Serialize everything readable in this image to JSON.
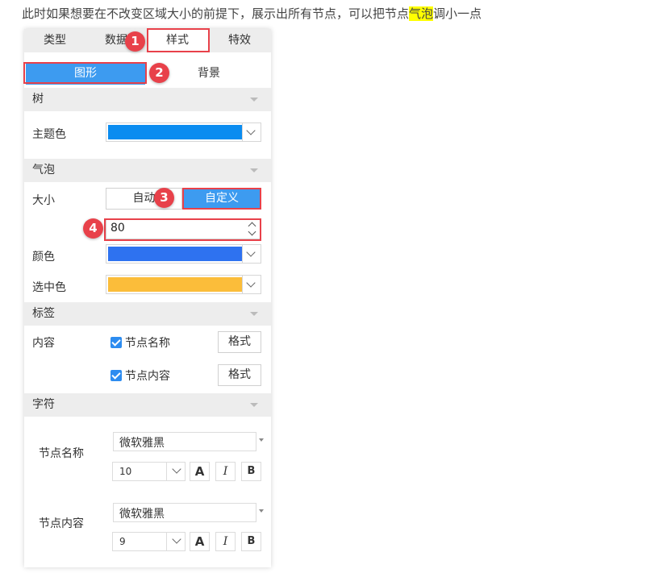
{
  "intro": {
    "before": "此时如果想要在不改变区域大小的前提下，展示出所有节点，可以把节点",
    "highlight": "气泡",
    "after": "调小一点"
  },
  "tabs": [
    {
      "label": "类型"
    },
    {
      "label": "数据"
    },
    {
      "label": "样式"
    },
    {
      "label": "特效"
    }
  ],
  "subtabs": [
    {
      "label": "图形"
    },
    {
      "label": "背景"
    }
  ],
  "tree": {
    "section": "树",
    "theme_label": "主题色",
    "theme_color": "#0a8cf0"
  },
  "bubble": {
    "section": "气泡",
    "size_label": "大小",
    "size_auto": "自动",
    "size_custom": "自定义",
    "size_value": "80",
    "color_label": "颜色",
    "color_value": "#2e72f0",
    "selected_label": "选中色",
    "selected_color": "#fbbd3a"
  },
  "label": {
    "section": "标签",
    "content_label": "内容",
    "opt1": "节点名称",
    "opt2": "节点内容",
    "format_btn": "格式"
  },
  "font": {
    "section": "字符",
    "name_label": "节点名称",
    "name_font": "微软雅黑",
    "name_size": "10",
    "content_label": "节点内容",
    "content_font": "微软雅黑",
    "content_size": "9",
    "bold": "A",
    "italic": "I",
    "b": "B"
  },
  "callouts": [
    "1",
    "2",
    "3",
    "4"
  ]
}
